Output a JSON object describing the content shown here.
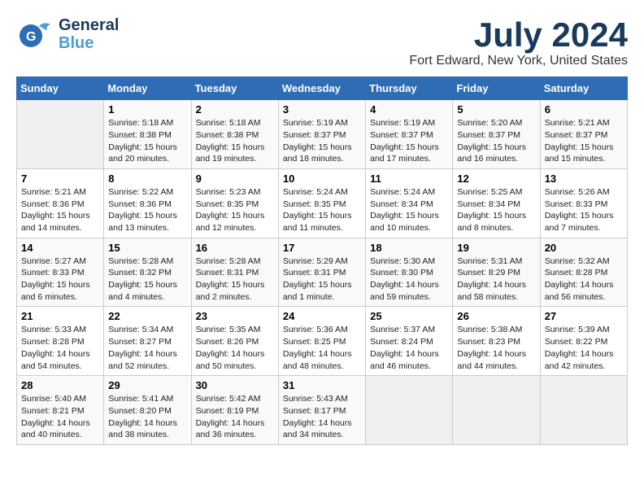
{
  "header": {
    "logo_line1": "General",
    "logo_line2": "Blue",
    "month": "July 2024",
    "location": "Fort Edward, New York, United States"
  },
  "weekdays": [
    "Sunday",
    "Monday",
    "Tuesday",
    "Wednesday",
    "Thursday",
    "Friday",
    "Saturday"
  ],
  "weeks": [
    [
      {
        "day": "",
        "info": ""
      },
      {
        "day": "1",
        "info": "Sunrise: 5:18 AM\nSunset: 8:38 PM\nDaylight: 15 hours\nand 20 minutes."
      },
      {
        "day": "2",
        "info": "Sunrise: 5:18 AM\nSunset: 8:38 PM\nDaylight: 15 hours\nand 19 minutes."
      },
      {
        "day": "3",
        "info": "Sunrise: 5:19 AM\nSunset: 8:37 PM\nDaylight: 15 hours\nand 18 minutes."
      },
      {
        "day": "4",
        "info": "Sunrise: 5:19 AM\nSunset: 8:37 PM\nDaylight: 15 hours\nand 17 minutes."
      },
      {
        "day": "5",
        "info": "Sunrise: 5:20 AM\nSunset: 8:37 PM\nDaylight: 15 hours\nand 16 minutes."
      },
      {
        "day": "6",
        "info": "Sunrise: 5:21 AM\nSunset: 8:37 PM\nDaylight: 15 hours\nand 15 minutes."
      }
    ],
    [
      {
        "day": "7",
        "info": "Sunrise: 5:21 AM\nSunset: 8:36 PM\nDaylight: 15 hours\nand 14 minutes."
      },
      {
        "day": "8",
        "info": "Sunrise: 5:22 AM\nSunset: 8:36 PM\nDaylight: 15 hours\nand 13 minutes."
      },
      {
        "day": "9",
        "info": "Sunrise: 5:23 AM\nSunset: 8:35 PM\nDaylight: 15 hours\nand 12 minutes."
      },
      {
        "day": "10",
        "info": "Sunrise: 5:24 AM\nSunset: 8:35 PM\nDaylight: 15 hours\nand 11 minutes."
      },
      {
        "day": "11",
        "info": "Sunrise: 5:24 AM\nSunset: 8:34 PM\nDaylight: 15 hours\nand 10 minutes."
      },
      {
        "day": "12",
        "info": "Sunrise: 5:25 AM\nSunset: 8:34 PM\nDaylight: 15 hours\nand 8 minutes."
      },
      {
        "day": "13",
        "info": "Sunrise: 5:26 AM\nSunset: 8:33 PM\nDaylight: 15 hours\nand 7 minutes."
      }
    ],
    [
      {
        "day": "14",
        "info": "Sunrise: 5:27 AM\nSunset: 8:33 PM\nDaylight: 15 hours\nand 6 minutes."
      },
      {
        "day": "15",
        "info": "Sunrise: 5:28 AM\nSunset: 8:32 PM\nDaylight: 15 hours\nand 4 minutes."
      },
      {
        "day": "16",
        "info": "Sunrise: 5:28 AM\nSunset: 8:31 PM\nDaylight: 15 hours\nand 2 minutes."
      },
      {
        "day": "17",
        "info": "Sunrise: 5:29 AM\nSunset: 8:31 PM\nDaylight: 15 hours\nand 1 minute."
      },
      {
        "day": "18",
        "info": "Sunrise: 5:30 AM\nSunset: 8:30 PM\nDaylight: 14 hours\nand 59 minutes."
      },
      {
        "day": "19",
        "info": "Sunrise: 5:31 AM\nSunset: 8:29 PM\nDaylight: 14 hours\nand 58 minutes."
      },
      {
        "day": "20",
        "info": "Sunrise: 5:32 AM\nSunset: 8:28 PM\nDaylight: 14 hours\nand 56 minutes."
      }
    ],
    [
      {
        "day": "21",
        "info": "Sunrise: 5:33 AM\nSunset: 8:28 PM\nDaylight: 14 hours\nand 54 minutes."
      },
      {
        "day": "22",
        "info": "Sunrise: 5:34 AM\nSunset: 8:27 PM\nDaylight: 14 hours\nand 52 minutes."
      },
      {
        "day": "23",
        "info": "Sunrise: 5:35 AM\nSunset: 8:26 PM\nDaylight: 14 hours\nand 50 minutes."
      },
      {
        "day": "24",
        "info": "Sunrise: 5:36 AM\nSunset: 8:25 PM\nDaylight: 14 hours\nand 48 minutes."
      },
      {
        "day": "25",
        "info": "Sunrise: 5:37 AM\nSunset: 8:24 PM\nDaylight: 14 hours\nand 46 minutes."
      },
      {
        "day": "26",
        "info": "Sunrise: 5:38 AM\nSunset: 8:23 PM\nDaylight: 14 hours\nand 44 minutes."
      },
      {
        "day": "27",
        "info": "Sunrise: 5:39 AM\nSunset: 8:22 PM\nDaylight: 14 hours\nand 42 minutes."
      }
    ],
    [
      {
        "day": "28",
        "info": "Sunrise: 5:40 AM\nSunset: 8:21 PM\nDaylight: 14 hours\nand 40 minutes."
      },
      {
        "day": "29",
        "info": "Sunrise: 5:41 AM\nSunset: 8:20 PM\nDaylight: 14 hours\nand 38 minutes."
      },
      {
        "day": "30",
        "info": "Sunrise: 5:42 AM\nSunset: 8:19 PM\nDaylight: 14 hours\nand 36 minutes."
      },
      {
        "day": "31",
        "info": "Sunrise: 5:43 AM\nSunset: 8:17 PM\nDaylight: 14 hours\nand 34 minutes."
      },
      {
        "day": "",
        "info": ""
      },
      {
        "day": "",
        "info": ""
      },
      {
        "day": "",
        "info": ""
      }
    ]
  ]
}
